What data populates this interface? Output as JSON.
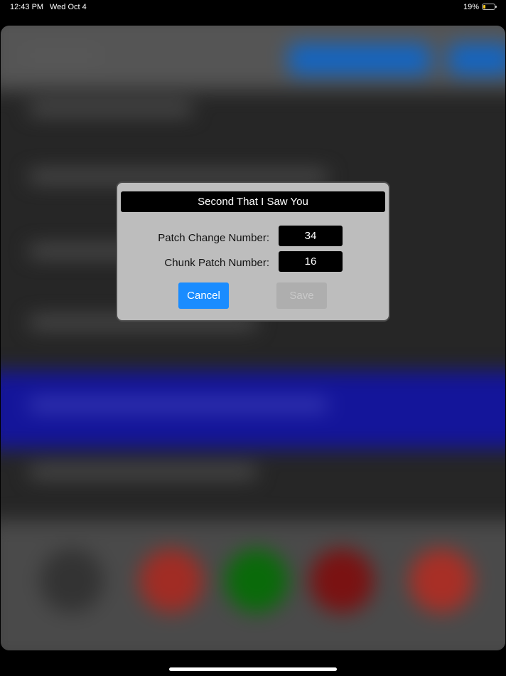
{
  "status_bar": {
    "time": "12:43 PM",
    "date": "Wed Oct 4",
    "battery_percent": "19%",
    "battery_level": 0.19
  },
  "dialog": {
    "title": "Second That I Saw You",
    "fields": [
      {
        "label": "Patch Change Number:",
        "value": "34"
      },
      {
        "label": "Chunk Patch Number:",
        "value": "16"
      }
    ],
    "cancel_label": "Cancel",
    "save_label": "Save",
    "save_enabled": false
  },
  "colors": {
    "accent": "#1a8cff",
    "dialog_background": "#bdbdbd",
    "band": "#14159a"
  }
}
